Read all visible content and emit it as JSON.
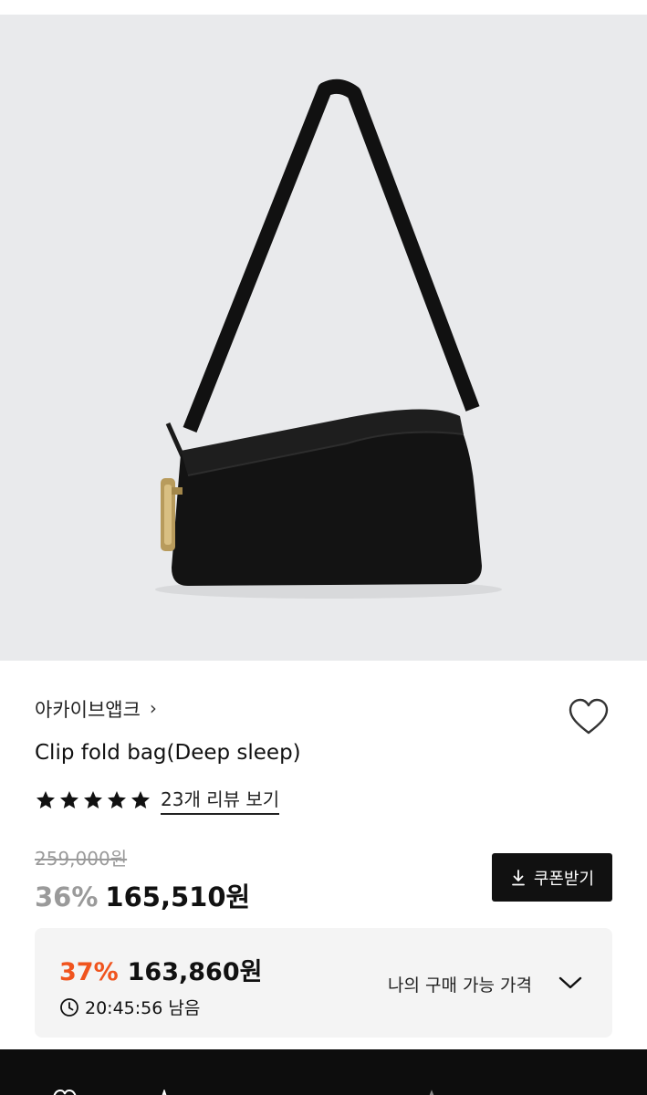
{
  "product": {
    "brand": "아카이브앱크",
    "brand_chevron": "›",
    "title": "Clip fold bag(Deep sleep)",
    "rating_stars": 5,
    "review_link": "23개 리뷰 보기",
    "original_price": "259,000원",
    "discount_rate": "36%",
    "sale_price": "165,510원"
  },
  "coupon": {
    "label": "쿠폰받기"
  },
  "my_price": {
    "discount_rate": "37%",
    "price": "163,860원",
    "time_left": "20:45:56 남음",
    "label": "나의 구매 가능 가격"
  },
  "colors": {
    "accent": "#f0541e",
    "dark": "#111111",
    "muted": "#9a9a9a",
    "image_background": "#e9eaec"
  },
  "icons": [
    "heart-icon",
    "star-icon",
    "download-icon",
    "clock-icon",
    "chevron-down-icon"
  ]
}
